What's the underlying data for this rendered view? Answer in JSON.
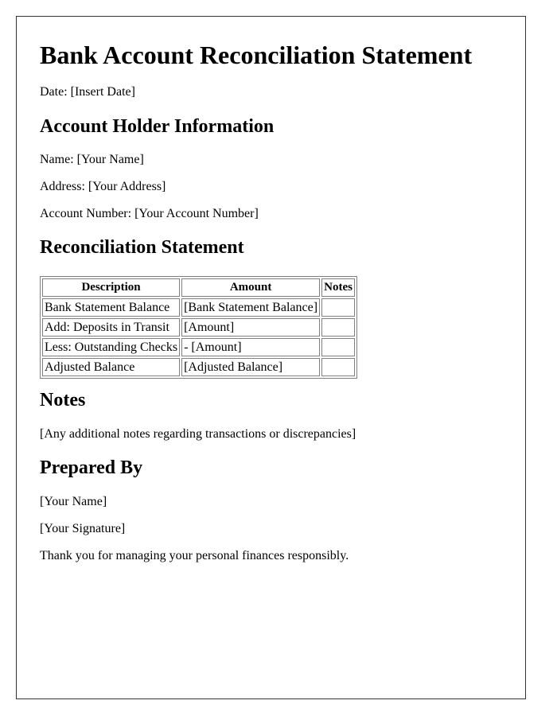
{
  "title": "Bank Account Reconciliation Statement",
  "date_line": "Date: [Insert Date]",
  "account_holder": {
    "heading": "Account Holder Information",
    "name_line": "Name: [Your Name]",
    "address_line": "Address: [Your Address]",
    "account_number_line": "Account Number: [Your Account Number]"
  },
  "reconciliation": {
    "heading": "Reconciliation Statement",
    "columns": [
      "Description",
      "Amount",
      "Notes"
    ],
    "rows": [
      {
        "description": "Bank Statement Balance",
        "amount": "[Bank Statement Balance]",
        "notes": ""
      },
      {
        "description": "Add: Deposits in Transit",
        "amount": "[Amount]",
        "notes": ""
      },
      {
        "description": "Less: Outstanding Checks",
        "amount": "- [Amount]",
        "notes": ""
      },
      {
        "description": "Adjusted Balance",
        "amount": "[Adjusted Balance]",
        "notes": ""
      }
    ]
  },
  "notes": {
    "heading": "Notes",
    "text": "[Any additional notes regarding transactions or discrepancies]"
  },
  "prepared_by": {
    "heading": "Prepared By",
    "name": "[Your Name]",
    "signature": "[Your Signature]"
  },
  "closing": "Thank you for managing your personal finances responsibly."
}
